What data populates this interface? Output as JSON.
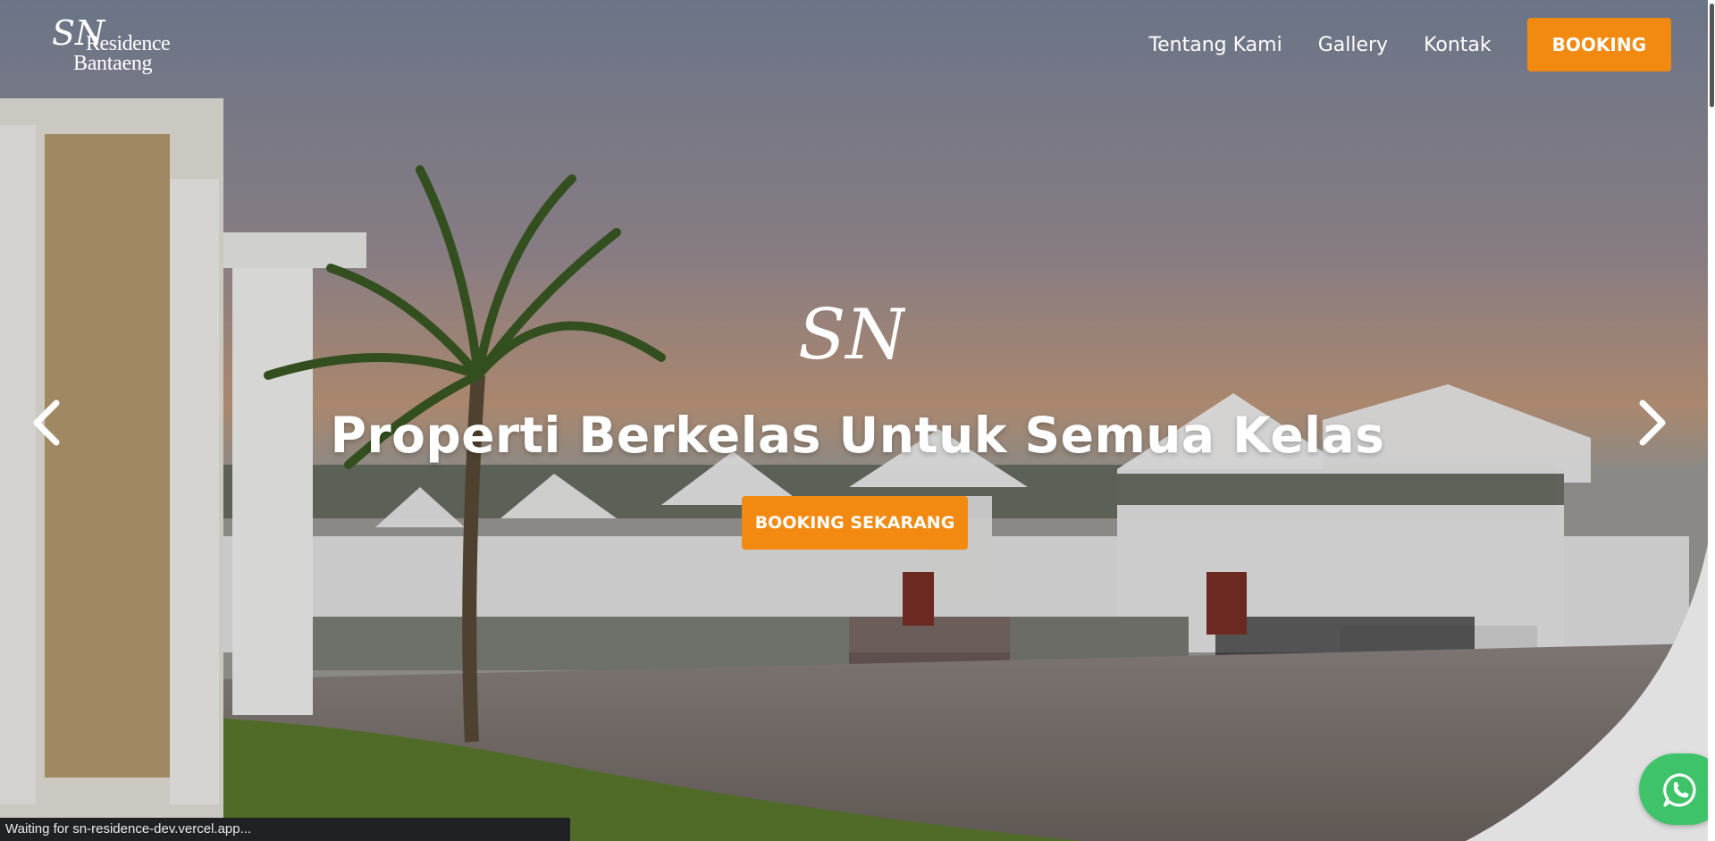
{
  "brand": {
    "monogram": "SN",
    "line1": "Residence",
    "line2": "Bantaeng"
  },
  "nav": {
    "items": [
      {
        "label": "Tentang Kami"
      },
      {
        "label": "Gallery"
      },
      {
        "label": "Kontak"
      }
    ],
    "booking_label": "BOOKING"
  },
  "hero": {
    "monogram": "SN",
    "headline": "Properti Berkelas Untuk Semua Kelas",
    "cta_label": "BOOKING SEKARANG"
  },
  "icons": {
    "prev": "chevron-left-icon",
    "next": "chevron-right-icon",
    "whatsapp": "whatsapp-icon"
  },
  "colors": {
    "accent": "#f28a12",
    "whatsapp": "#3fc36a",
    "text_on_image": "#ffffff"
  },
  "status_bar": {
    "text": "Waiting for sn-residence-dev.vercel.app..."
  }
}
